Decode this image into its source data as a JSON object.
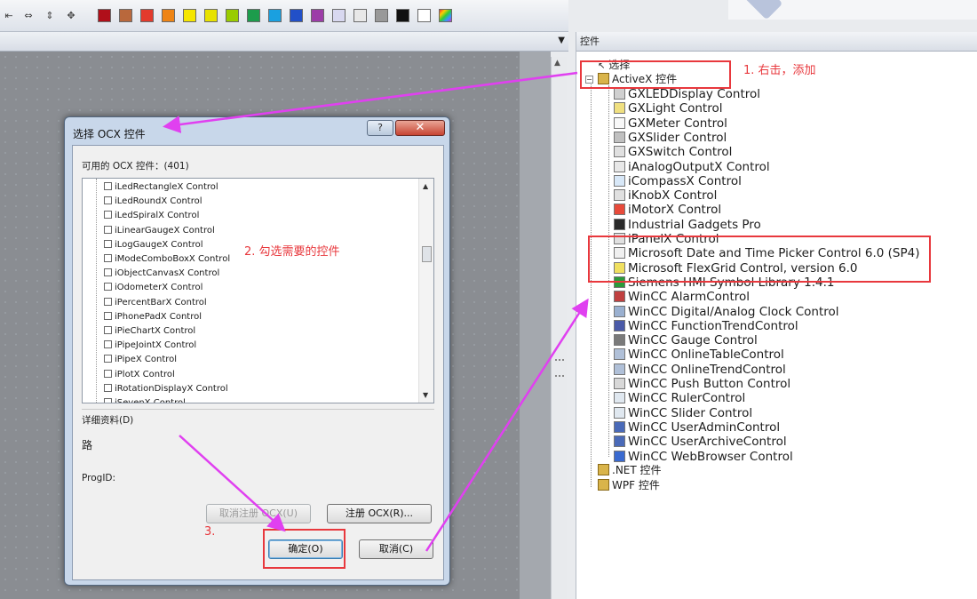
{
  "toolbar": {
    "icons": [
      "align-left-icon",
      "align-center-icon",
      "align-vertical-icon",
      "move-icon"
    ],
    "palette": [
      "#b00f1a",
      "#b9683c",
      "#e33a2c",
      "#ee8414",
      "#f5e600",
      "#e8e200",
      "#99cc00",
      "#1d9c4c",
      "#1aa0e0",
      "#2250c8",
      "#9c3ca8",
      "#d8d8f0",
      "#e8e8e8",
      "#999999",
      "#111111",
      "#ffffff",
      "multicolor"
    ]
  },
  "panel": {
    "header": "控件",
    "select_label": "选择",
    "activex_label": "ActiveX 控件",
    "items": [
      {
        "label": "GXLEDDisplay Control",
        "icon": "led-display-icon"
      },
      {
        "label": "GXLight Control",
        "icon": "light-icon"
      },
      {
        "label": "GXMeter Control",
        "icon": "meter-icon"
      },
      {
        "label": "GXSlider Control",
        "icon": "slider-icon"
      },
      {
        "label": "GXSwitch Control",
        "icon": "switch-icon"
      },
      {
        "label": "iAnalogOutputX Control",
        "icon": "analog-output-icon"
      },
      {
        "label": "iCompassX Control",
        "icon": "compass-icon"
      },
      {
        "label": "iKnobX Control",
        "icon": "knob-icon"
      },
      {
        "label": "iMotorX Control",
        "icon": "motor-icon"
      },
      {
        "label": "Industrial Gadgets Pro",
        "icon": "gadgets-icon"
      },
      {
        "label": "iPanelX Control",
        "icon": "panel-icon"
      },
      {
        "label": "Microsoft Date and Time Picker Control 6.0 (SP4)",
        "icon": "date-picker-icon"
      },
      {
        "label": "Microsoft FlexGrid Control, version 6.0",
        "icon": "flexgrid-icon"
      },
      {
        "label": "Siemens HMI Symbol Library 1.4.1",
        "icon": "symbol-library-icon"
      },
      {
        "label": "WinCC AlarmControl",
        "icon": "alarm-icon"
      },
      {
        "label": "WinCC Digital/Analog Clock Control",
        "icon": "clock-icon"
      },
      {
        "label": "WinCC FunctionTrendControl",
        "icon": "function-trend-icon"
      },
      {
        "label": "WinCC Gauge Control",
        "icon": "gauge-icon"
      },
      {
        "label": "WinCC OnlineTableControl",
        "icon": "table-icon"
      },
      {
        "label": "WinCC OnlineTrendControl",
        "icon": "trend-icon"
      },
      {
        "label": "WinCC Push Button Control",
        "icon": "push-button-icon"
      },
      {
        "label": "WinCC RulerControl",
        "icon": "ruler-icon"
      },
      {
        "label": "WinCC Slider Control",
        "icon": "slider-control-icon"
      },
      {
        "label": "WinCC UserAdminControl",
        "icon": "user-admin-icon"
      },
      {
        "label": "WinCC UserArchiveControl",
        "icon": "user-archive-icon"
      },
      {
        "label": "WinCC WebBrowser Control",
        "icon": "web-browser-icon"
      }
    ],
    "net_label": ".NET 控件",
    "wpf_label": "WPF 控件"
  },
  "dialog": {
    "title": "选择 OCX 控件",
    "help": "?",
    "close": "✕",
    "available_label": "可用的 OCX 控件：(401)",
    "ocx_items": [
      "iLedRectangleX Control",
      "iLedRoundX Control",
      "iLedSpiralX Control",
      "iLinearGaugeX Control",
      "iLogGaugeX Control",
      "iModeComboBoxX Control",
      "iObjectCanvasX Control",
      "iOdometerX Control",
      "iPercentBarX Control",
      "iPhonePadX Control",
      "iPieChartX Control",
      "iPipeJointX Control",
      "iPipeX Control",
      "iPlotX Control",
      "iRotationDisplayX Control",
      "iSevenX Control"
    ],
    "details_label": "详细资料(D)",
    "details_value": "路",
    "progid_label": "ProgID:",
    "unregister_btn": "取消注册 OCX(U)",
    "register_btn": "注册 OCX(R)...",
    "ok_btn": "确定(O)",
    "cancel_btn": "取消(C)"
  },
  "annotations": {
    "step1": "1. 右击，添加",
    "step2": "2. 勾选需要的控件",
    "step3": "3.",
    "red": "#e8383d",
    "magenta": "#e040f0"
  }
}
